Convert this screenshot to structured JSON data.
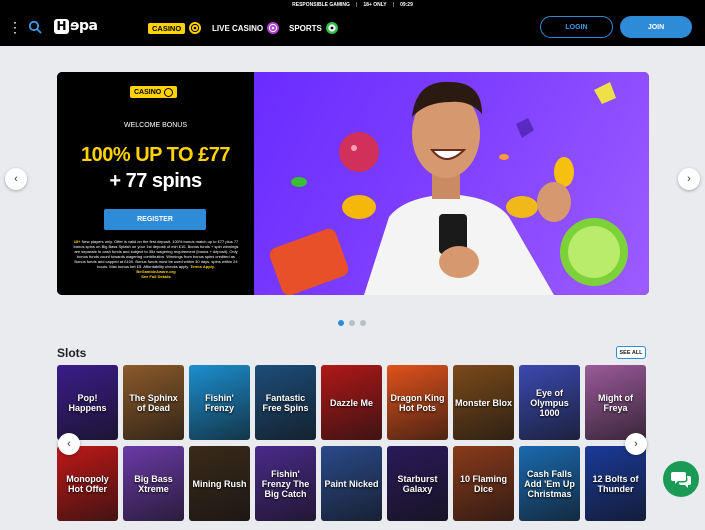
{
  "notice": {
    "item1": "RESPONSIBLE GAMING",
    "item2": "18+ ONLY",
    "time": "09:29"
  },
  "header": {
    "logo_letter": "H",
    "logo_rest": "ɘpa",
    "nav": {
      "casino": "CASINO",
      "live_casino": "LIVE CASINO",
      "sports": "SPORTS"
    },
    "login": "LOGIN",
    "join": "JOIN"
  },
  "hero": {
    "tag": "CASINO",
    "welcome": "WELCOME BONUS",
    "offer_line1": "100% UP TO £77",
    "offer_line2": "+ 77 spins",
    "register": "REGISTER",
    "terms_prefix": "18+",
    "terms": "New players only. Offer is valid on the first deposit. 100% bonus match up to £77 plus 77 bonus spins on Big Bass Splash on your 1st deposit of min £10. Bonus funds + spin winnings are separate to cash funds and subject to 35x wagering requirement (bonus + deposit). Only bonus funds count towards wagering contribution. Winnings from bonus spins credited as Bonus funds and capped at £100. Bonus funds must be used within 30 days, spins within 24 hours. Max bonus bet £5.",
    "terms_more": "Affordability checks apply.",
    "terms_apply": "Terms Apply.",
    "gamble_aware": "BeGambleAware.org",
    "see_details": "See Full Details"
  },
  "carousel": {
    "slides": 3,
    "active": 1
  },
  "slots": {
    "title": "Slots",
    "see_all": "SEE ALL",
    "games": [
      {
        "name": "Pop! Happens",
        "color": "#3a1d8a"
      },
      {
        "name": "The Sphinx of Dead",
        "color": "#8a5a2a"
      },
      {
        "name": "Fishin' Frenzy",
        "color": "#1b8fd0"
      },
      {
        "name": "Fantastic Free Spins",
        "color": "#1c4d7a"
      },
      {
        "name": "Dazzle Me",
        "color": "#b01818"
      },
      {
        "name": "Dragon King Hot Pots",
        "color": "#e0521b"
      },
      {
        "name": "Monster Blox",
        "color": "#7a4a1a"
      },
      {
        "name": "Eye of Olympus 1000",
        "color": "#3a4ab0"
      },
      {
        "name": "Might of Freya",
        "color": "#9a5a9a"
      },
      {
        "name": "Monopoly Hot Offer",
        "color": "#c01818"
      },
      {
        "name": "Big Bass Xtreme",
        "color": "#6a3aa8"
      },
      {
        "name": "Mining Rush",
        "color": "#3a2a1a"
      },
      {
        "name": "Fishin' Frenzy The Big Catch",
        "color": "#4a2a8a"
      },
      {
        "name": "Paint Nicked",
        "color": "#2a4a8a"
      },
      {
        "name": "Starburst Galaxy",
        "color": "#2a1a5a"
      },
      {
        "name": "10 Flaming Dice",
        "color": "#8a3a1a"
      },
      {
        "name": "Cash Falls Add 'Em Up Christmas",
        "color": "#1a6ab0"
      },
      {
        "name": "12 Bolts of Thunder",
        "color": "#1a3a9a"
      }
    ]
  },
  "colors": {
    "accent": "#2e8bd8",
    "brand_yellow": "#ffd200",
    "chat": "#1a9a54"
  },
  "icons": {
    "menu": "kebab-menu-icon",
    "search": "search-icon",
    "chat": "chat-icon",
    "prev": "chevron-left-icon",
    "next": "chevron-right-icon"
  }
}
